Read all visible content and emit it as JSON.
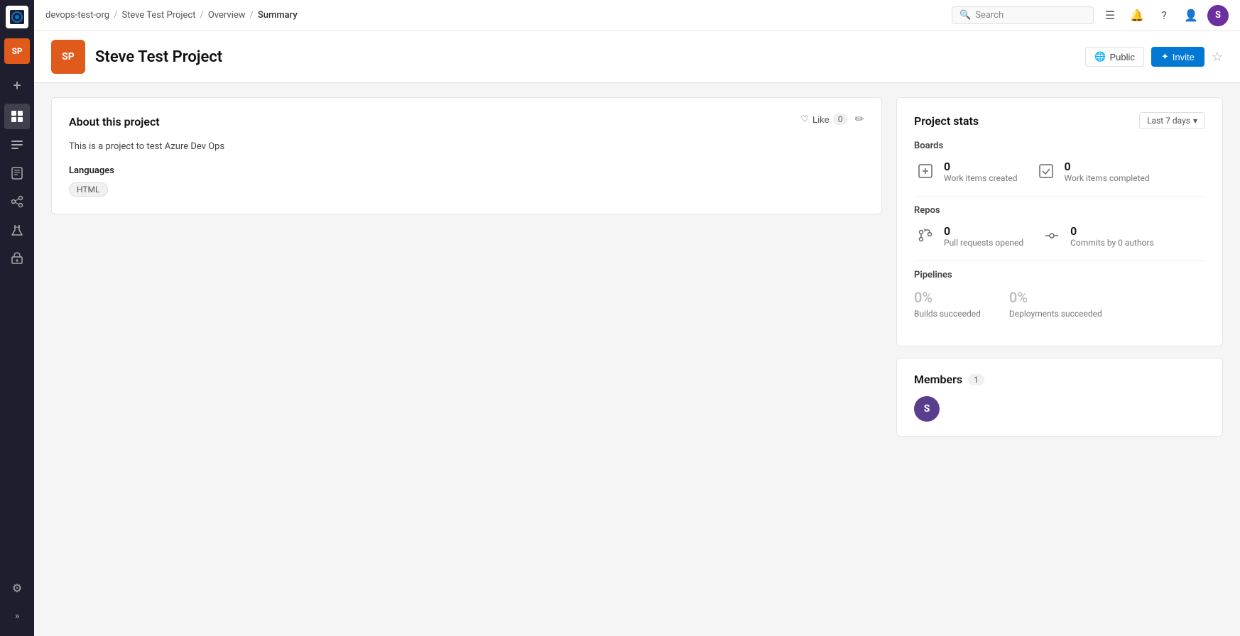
{
  "sidebar": {
    "logo": "A",
    "nav_items": [
      {
        "id": "boards",
        "icon": "⊞",
        "active": false
      },
      {
        "id": "overview",
        "icon": "🏠",
        "active": true
      },
      {
        "id": "boards2",
        "icon": "☰",
        "active": false
      },
      {
        "id": "repos",
        "icon": "📋",
        "active": false
      },
      {
        "id": "pipelines",
        "icon": "▷",
        "active": false
      },
      {
        "id": "test",
        "icon": "🧪",
        "active": false
      },
      {
        "id": "artifacts",
        "icon": "📦",
        "active": false
      }
    ],
    "project_icon": "SP",
    "settings_icon": "⚙",
    "expand_icon": "»"
  },
  "topbar": {
    "breadcrumb": {
      "org": "devops-test-org",
      "project": "Steve Test Project",
      "section": "Overview",
      "page": "Summary"
    },
    "search_placeholder": "Search",
    "icons": [
      "☰",
      "📋",
      "?",
      "👤"
    ],
    "user_initial": "S"
  },
  "project_header": {
    "avatar_text": "SP",
    "avatar_color": "#e05a1c",
    "project_name": "Steve Test Project",
    "visibility_label": "Public",
    "invite_label": "Invite",
    "star_icon": "☆"
  },
  "about": {
    "title": "About this project",
    "like_label": "Like",
    "like_count": "0",
    "description": "This is a project to test Azure Dev Ops",
    "languages_label": "Languages",
    "languages": [
      "HTML"
    ]
  },
  "project_stats": {
    "title": "Project stats",
    "date_filter": "Last 7 days",
    "boards": {
      "label": "Boards",
      "work_items_created": {
        "count": "0",
        "label": "Work items created"
      },
      "work_items_completed": {
        "count": "0",
        "label": "Work items completed"
      }
    },
    "repos": {
      "label": "Repos",
      "pull_requests": {
        "count": "0",
        "label": "Pull requests opened"
      },
      "commits": {
        "count": "0",
        "label": "Commits by 0 authors"
      }
    },
    "pipelines": {
      "label": "Pipelines",
      "builds": {
        "percent": "0%",
        "label": "Builds succeeded"
      },
      "deployments": {
        "percent": "0%",
        "label": "Deployments succeeded"
      }
    }
  },
  "members": {
    "title": "Members",
    "count": "1",
    "list": [
      {
        "initial": "S",
        "color": "#5a3e8e"
      }
    ]
  }
}
